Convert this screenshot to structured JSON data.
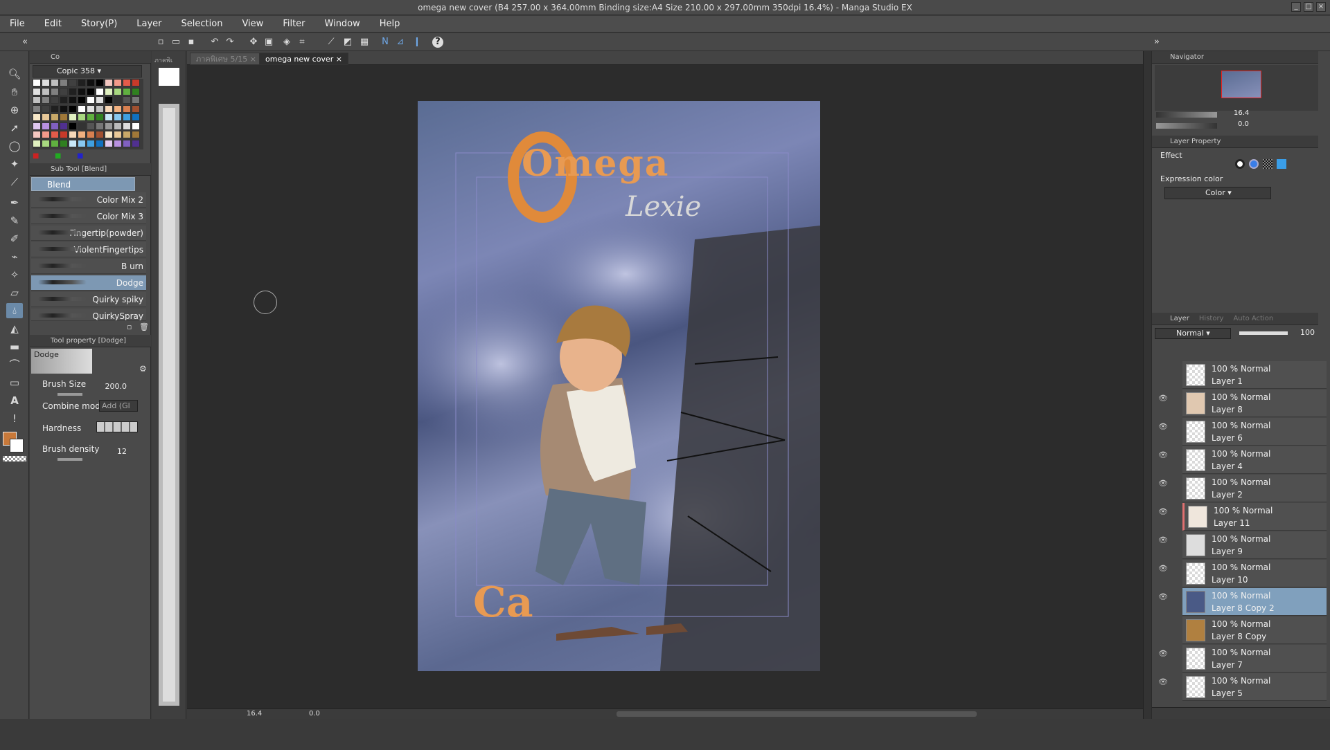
{
  "window": {
    "title": "omega new cover (B4 257.00 x 364.00mm Binding size:A4 Size 210.00 x 297.00mm 350dpi 16.4%) - Manga Studio EX",
    "minimize": "_",
    "maximize": "□",
    "close": "×"
  },
  "menu": [
    "File",
    "Edit",
    "Story(P)",
    "Layer",
    "Selection",
    "View",
    "Filter",
    "Window",
    "Help"
  ],
  "colors": {
    "accent": "#7d98b3",
    "selected_layer": "#80a0bd",
    "main_color": "#c8793a",
    "sub_color": "#ffffff"
  },
  "left": {
    "palette_title": "Copic 358",
    "palette_tab": "Co",
    "subtool_header": "Sub Tool [Blend]",
    "subtool_group": "Blend",
    "brushes": [
      "Color Mix 2",
      "Color Mix 3",
      "Fingertip(powder)",
      "ViolentFingertips",
      "B urn",
      "Dodge",
      "Quirky spiky",
      "QuirkySpray"
    ],
    "toolprop_header": "Tool property [Dodge]",
    "toolprop_name": "Dodge",
    "brush_size_label": "Brush Size",
    "brush_size_value": "200.0",
    "combine_label": "Combine mode",
    "combine_value": "Add (Gl",
    "hardness_label": "Hardness",
    "density_label": "Brush density",
    "density_value": "12"
  },
  "doc_tabs": {
    "tab1": "ภาคพิเ",
    "tab2": "ภาคพิเศษ",
    "tab2_page": "5/15",
    "tab3": "omega new cover"
  },
  "artwork": {
    "title_top": "Omega",
    "title_mid": "Lexie",
    "title_bottom": "Ca"
  },
  "status": {
    "zoom": "16.4",
    "angle": "0.0"
  },
  "right": {
    "navigator_header": "Navigator",
    "nav_zoom": "16.4",
    "nav_angle": "0.0",
    "layerprop_header": "Layer Property",
    "effect_label": "Effect",
    "expression_label": "Expression color",
    "expression_value": "Color",
    "layer_tabs": [
      "Layer",
      "History",
      "Auto Action"
    ],
    "blend_mode": "Normal",
    "opacity": "100",
    "layers": [
      {
        "opacity": "100 %",
        "mode": "Normal",
        "name": "Layer 1",
        "visible": false
      },
      {
        "opacity": "100 %",
        "mode": "Normal",
        "name": "Layer 8",
        "visible": true
      },
      {
        "opacity": "100 %",
        "mode": "Normal",
        "name": "Layer 6",
        "visible": true
      },
      {
        "opacity": "100 %",
        "mode": "Normal",
        "name": "Layer 4",
        "visible": true
      },
      {
        "opacity": "100 %",
        "mode": "Normal",
        "name": "Layer 2",
        "visible": true
      },
      {
        "opacity": "100 %",
        "mode": "Normal",
        "name": "Layer 11",
        "visible": true
      },
      {
        "opacity": "100 %",
        "mode": "Normal",
        "name": "Layer 9",
        "visible": true
      },
      {
        "opacity": "100 %",
        "mode": "Normal",
        "name": "Layer 10",
        "visible": true
      },
      {
        "opacity": "100 %",
        "mode": "Normal",
        "name": "Layer 8 Copy 2",
        "visible": true
      },
      {
        "opacity": "100 %",
        "mode": "Normal",
        "name": "Layer 8 Copy",
        "visible": false
      },
      {
        "opacity": "100 %",
        "mode": "Normal",
        "name": "Layer 7",
        "visible": true
      },
      {
        "opacity": "100 %",
        "mode": "Normal",
        "name": "Layer 5",
        "visible": true
      }
    ]
  }
}
